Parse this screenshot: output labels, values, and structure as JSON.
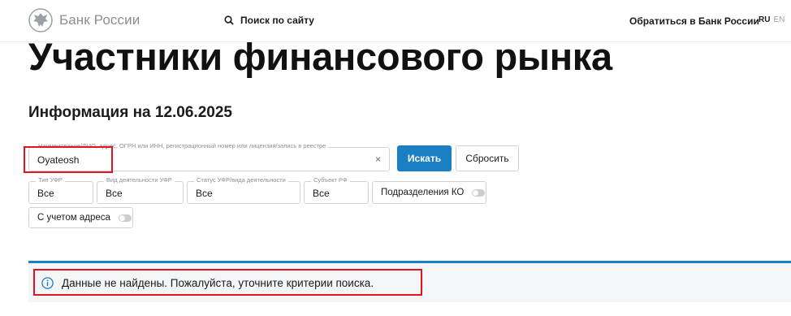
{
  "header": {
    "logo_text": "Банк России",
    "site_search_label": "Поиск по сайту",
    "contact_link": "Обратиться в Банк России",
    "lang_ru": "RU",
    "lang_en": "EN"
  },
  "page": {
    "title": "Участники финансового рынка",
    "info_date": "Информация на 12.06.2025"
  },
  "search": {
    "label": "Наименование/ФИО, адрес, ОГРН или ИНН, регистрационный номер или лицензия/запись в реестре",
    "value": "Oyateosh",
    "clear_symbol": "×",
    "search_button": "Искать",
    "reset_button": "Сбросить"
  },
  "filters": {
    "type_label": "Тип УФР",
    "type_value": "Все",
    "activity_label": "Вид деятельности УФР",
    "activity_value": "Все",
    "status_label": "Статус УФР/вида деятельности",
    "status_value": "Все",
    "subject_label": "Субъект РФ",
    "subject_value": "Все",
    "subdivisions_toggle": "Подразделения КО",
    "address_toggle": "С учетом адреса"
  },
  "result": {
    "message": "Данные не найдены. Пожалуйста, уточните критерии поиска.",
    "icon": "info-icon"
  },
  "colors": {
    "accent": "#1a7fc4",
    "highlight": "#e0141e",
    "notice_bg": "#f4f5f7"
  }
}
